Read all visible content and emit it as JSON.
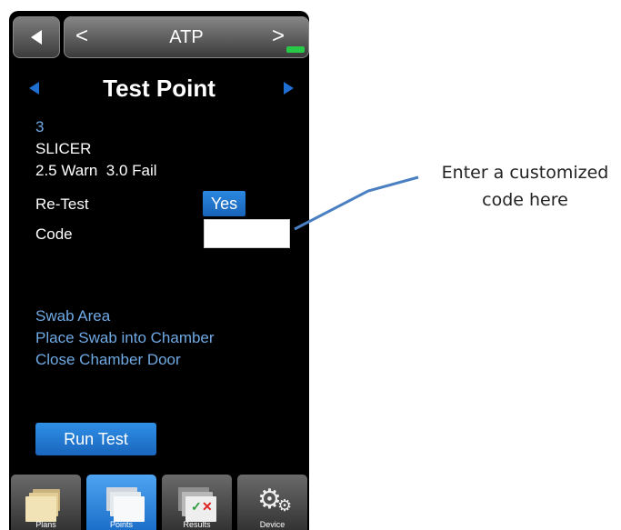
{
  "header": {
    "title": "ATP",
    "prev_glyph": "<",
    "next_glyph": ">"
  },
  "page": {
    "title": "Test Point"
  },
  "test_point": {
    "number": "3",
    "name": "SLICER",
    "thresholds": "2.5 Warn  3.0 Fail",
    "retest_label": "Re-Test",
    "retest_value": "Yes",
    "code_label": "Code",
    "code_value": ""
  },
  "instructions": [
    "Swab Area",
    "Place Swab into Chamber",
    "Close Chamber Door"
  ],
  "run_button_label": "Run Test",
  "tabs": [
    {
      "label": "Plans"
    },
    {
      "label": "Points"
    },
    {
      "label": "Results"
    },
    {
      "label": "Device"
    }
  ],
  "callout": {
    "line1": "Enter a customized",
    "line2": "code here"
  },
  "colors": {
    "accent": "#1e6fd1",
    "text_blue": "#6ea9e3",
    "battery": "#29c948"
  }
}
